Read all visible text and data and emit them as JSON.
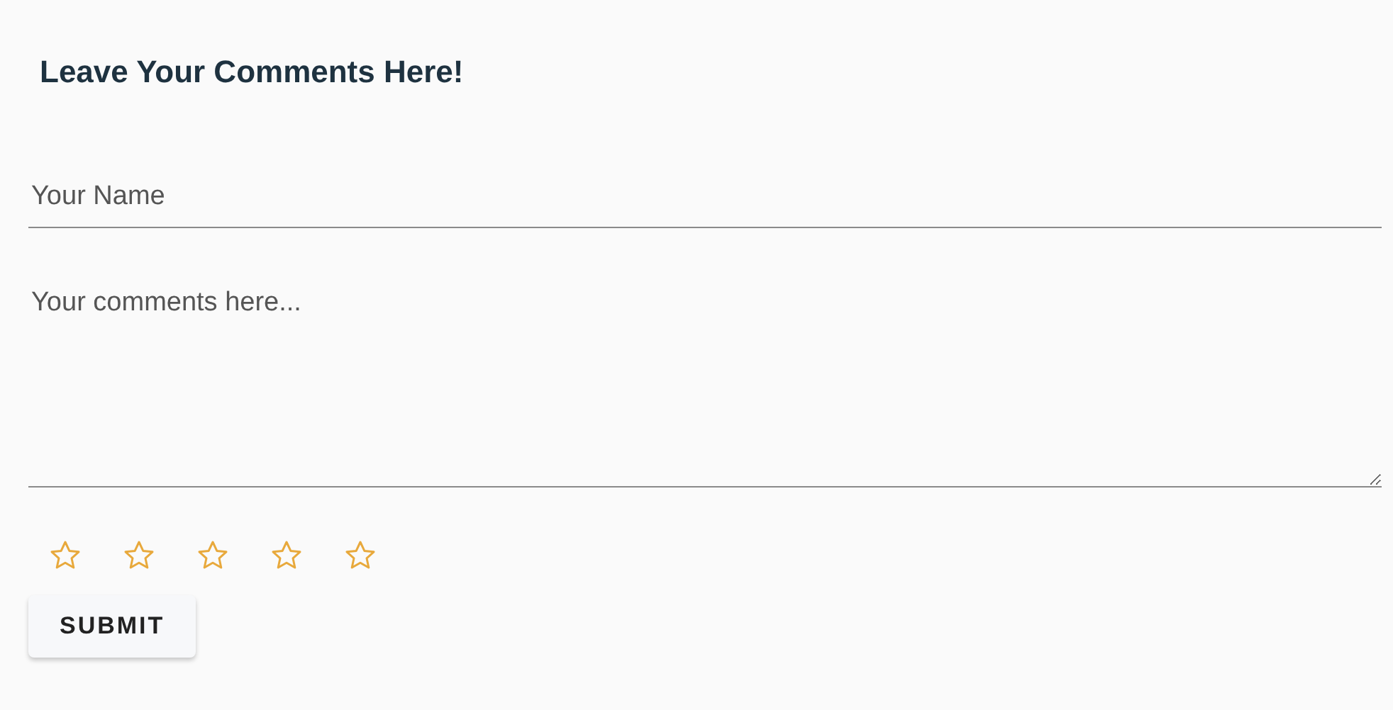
{
  "title": "Leave Your Comments Here!",
  "name_field": {
    "placeholder": "Your Name"
  },
  "comments_field": {
    "placeholder": "Your comments here..."
  },
  "rating": {
    "stars": 0
  },
  "submit_button": {
    "label": "SUBMIT"
  }
}
